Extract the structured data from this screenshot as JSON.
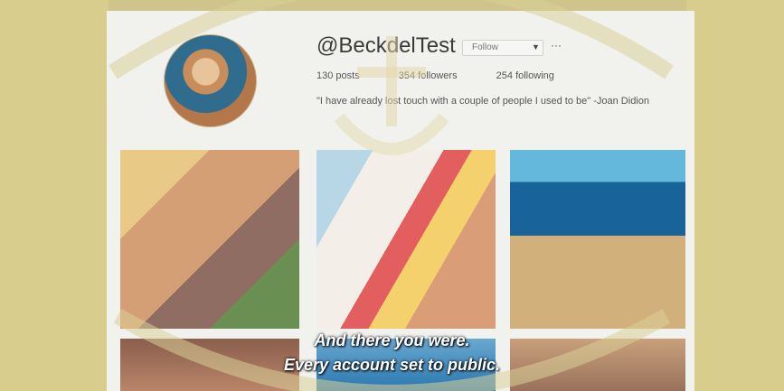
{
  "profile": {
    "handle": "@BeckdelTest",
    "follow_label": "Follow",
    "more_label": "···",
    "caret_label": "▼",
    "posts": "130 posts",
    "followers": "354 followers",
    "following": "254 following",
    "bio": "\"I have already lost touch with a couple of people I used to be\" -Joan Didion"
  },
  "subtitles": {
    "line1": "And there you were.",
    "line2": "Every account set to public."
  },
  "colors": {
    "watermark": "#d8cd8c",
    "page": "#f1f1ee"
  }
}
